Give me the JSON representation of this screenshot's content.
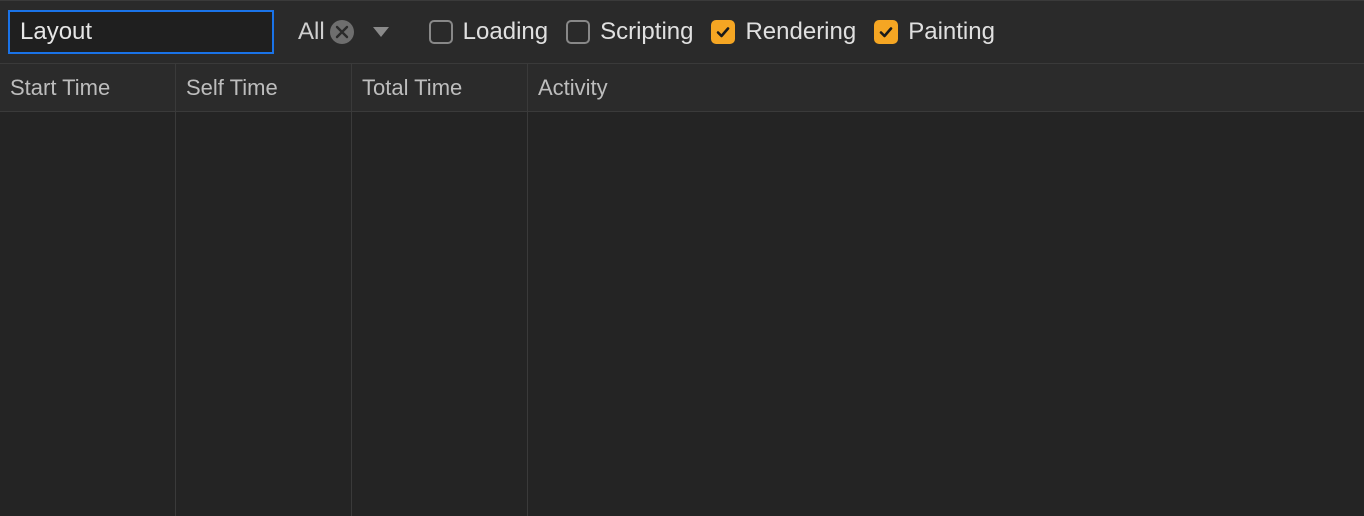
{
  "toolbar": {
    "search_value": "Layout",
    "dropdown_selected": "All",
    "checks": [
      {
        "label": "Loading",
        "checked": false
      },
      {
        "label": "Scripting",
        "checked": false
      },
      {
        "label": "Rendering",
        "checked": true
      },
      {
        "label": "Painting",
        "checked": true
      }
    ]
  },
  "table": {
    "headers": {
      "start": "Start Time",
      "self": "Self Time",
      "total": "Total Time",
      "activity": "Activity"
    },
    "rows": []
  },
  "colors": {
    "accent_checkbox": "#f5a623",
    "focus_border": "#1a73e8"
  }
}
